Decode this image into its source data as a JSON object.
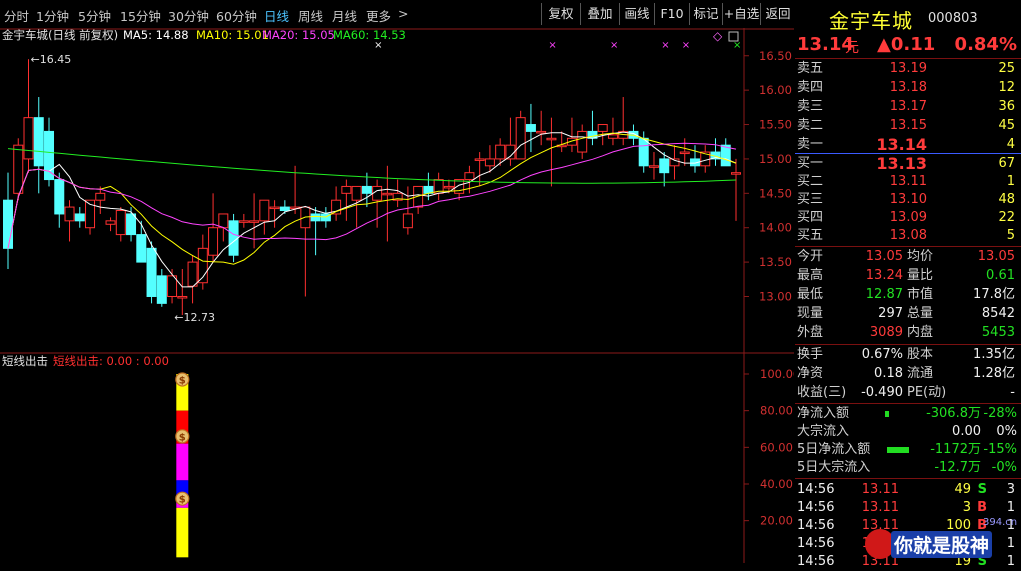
{
  "toolbar": {
    "timeframes": [
      "分时",
      "1分钟",
      "5分钟",
      "15分钟",
      "30分钟",
      "60分钟",
      "日线",
      "周线",
      "月线",
      "更多"
    ],
    "active": "日线",
    "more_arrow": ">",
    "buttons": [
      "复权",
      "叠加",
      "画线",
      "F10",
      "标记",
      "+自选",
      "返回"
    ]
  },
  "stock": {
    "name": "金宇车城",
    "code": "000803",
    "price": "13.14",
    "unit": "元",
    "change": "▲0.11",
    "pct": "0.84%"
  },
  "main_chart": {
    "header_title": "金宇车城(日线 前复权)",
    "ma": [
      {
        "label": "MA5: 14.88",
        "color": "#ffffff"
      },
      {
        "label": "MA10: 15.01",
        "color": "#ffff00"
      },
      {
        "label": "MA20: 15.05",
        "color": "#ff44ff"
      },
      {
        "label": "MA60: 14.53",
        "color": "#22ee22"
      }
    ],
    "high_label": "16.45",
    "low_label": "12.73",
    "y_ticks": [
      "16.50",
      "16.00",
      "15.50",
      "15.00",
      "14.50",
      "14.00",
      "13.50",
      "13.00"
    ],
    "marker_glyph": "×",
    "diamond_glyph": "◇"
  },
  "chart_data": {
    "type": "candlestick",
    "ylim": [
      12.6,
      16.7
    ],
    "candles": [
      [
        14.4,
        14.8,
        13.4,
        13.7
      ],
      [
        14.5,
        15.3,
        14.4,
        15.2
      ],
      [
        15.0,
        16.45,
        14.8,
        15.6
      ],
      [
        15.6,
        15.9,
        14.5,
        14.9
      ],
      [
        15.4,
        15.6,
        14.6,
        14.7
      ],
      [
        14.7,
        14.8,
        14.0,
        14.2
      ],
      [
        14.1,
        14.4,
        13.8,
        14.3
      ],
      [
        14.2,
        14.3,
        14.0,
        14.1
      ],
      [
        14.0,
        14.4,
        13.9,
        14.4
      ],
      [
        14.4,
        14.6,
        14.2,
        14.5
      ],
      [
        14.05,
        14.15,
        13.95,
        14.1
      ],
      [
        13.9,
        14.3,
        13.8,
        14.25
      ],
      [
        14.2,
        14.3,
        13.8,
        13.9
      ],
      [
        13.9,
        14.1,
        13.5,
        13.5
      ],
      [
        13.7,
        13.8,
        12.9,
        13.0
      ],
      [
        13.3,
        13.4,
        12.85,
        12.9
      ],
      [
        13.0,
        13.4,
        12.9,
        13.3
      ],
      [
        13.0,
        13.4,
        12.73,
        13.0
      ],
      [
        13.15,
        13.6,
        12.9,
        13.5
      ],
      [
        13.2,
        13.9,
        13.1,
        13.7
      ],
      [
        13.6,
        14.5,
        13.5,
        14.0
      ],
      [
        14.0,
        14.1,
        13.8,
        14.2
      ],
      [
        14.1,
        14.2,
        13.5,
        13.6
      ],
      [
        14.1,
        14.2,
        14.0,
        14.1
      ],
      [
        14.1,
        14.5,
        13.7,
        14.1
      ],
      [
        14.1,
        14.4,
        13.9,
        14.4
      ],
      [
        14.3,
        14.4,
        14.0,
        14.3
      ],
      [
        14.3,
        14.4,
        14.2,
        14.25
      ],
      [
        14.3,
        14.9,
        14.2,
        14.3
      ],
      [
        14.0,
        14.3,
        13.0,
        14.3
      ],
      [
        14.2,
        14.3,
        13.6,
        14.1
      ],
      [
        14.2,
        14.3,
        14.0,
        14.1
      ],
      [
        14.2,
        14.6,
        14.1,
        14.4
      ],
      [
        14.5,
        14.7,
        14.1,
        14.6
      ],
      [
        14.4,
        14.6,
        14.0,
        14.6
      ],
      [
        14.6,
        14.8,
        14.3,
        14.5
      ],
      [
        14.4,
        14.7,
        14.0,
        14.6
      ],
      [
        14.5,
        14.9,
        13.8,
        14.5
      ],
      [
        14.4,
        14.7,
        14.3,
        14.5
      ],
      [
        14.0,
        14.6,
        13.9,
        14.2
      ],
      [
        14.3,
        14.6,
        14.2,
        14.6
      ],
      [
        14.6,
        14.8,
        14.4,
        14.5
      ],
      [
        14.5,
        14.8,
        14.4,
        14.7
      ],
      [
        14.6,
        14.7,
        14.5,
        14.6
      ],
      [
        14.5,
        14.7,
        14.4,
        14.7
      ],
      [
        14.7,
        14.9,
        14.5,
        14.8
      ],
      [
        15.0,
        15.1,
        14.6,
        15.0
      ],
      [
        14.9,
        15.2,
        14.8,
        15.0
      ],
      [
        15.0,
        15.3,
        14.9,
        15.2
      ],
      [
        15.0,
        15.6,
        14.9,
        15.2
      ],
      [
        15.0,
        15.7,
        15.0,
        15.6
      ],
      [
        15.5,
        15.8,
        15.1,
        15.4
      ],
      [
        15.4,
        15.7,
        15.2,
        15.4
      ],
      [
        15.3,
        15.6,
        14.6,
        15.3
      ],
      [
        15.2,
        15.4,
        15.1,
        15.2
      ],
      [
        15.2,
        15.6,
        15.1,
        15.3
      ],
      [
        15.1,
        15.5,
        15.0,
        15.4
      ],
      [
        15.4,
        15.7,
        15.2,
        15.3
      ],
      [
        15.4,
        15.5,
        15.2,
        15.5
      ],
      [
        15.3,
        15.6,
        15.2,
        15.35
      ],
      [
        15.3,
        15.9,
        15.2,
        15.4
      ],
      [
        15.4,
        15.5,
        15.2,
        15.3
      ],
      [
        15.3,
        15.4,
        14.8,
        14.9
      ],
      [
        14.9,
        15.1,
        14.7,
        14.9
      ],
      [
        15.0,
        15.1,
        14.6,
        14.8
      ],
      [
        14.9,
        15.2,
        14.7,
        15.0
      ],
      [
        15.1,
        15.3,
        14.9,
        15.1
      ],
      [
        15.0,
        15.2,
        14.8,
        14.9
      ],
      [
        14.9,
        15.2,
        14.8,
        15.1
      ],
      [
        15.1,
        15.3,
        14.9,
        15.0
      ],
      [
        15.2,
        15.3,
        14.9,
        14.9
      ],
      [
        14.8,
        15.0,
        14.1,
        14.8
      ]
    ],
    "marks": [
      [
        36,
        "#f5f5f5"
      ],
      [
        53,
        "#ff44ff"
      ],
      [
        59,
        "#ff44ff"
      ],
      [
        71,
        "#22ee22"
      ]
    ]
  },
  "sub_chart": {
    "title": "短线出击",
    "value_label": "短线出击: 0.00 : 0.00",
    "y_ticks": [
      "100.00",
      "80.00",
      "60.00",
      "40.00",
      "20.00"
    ],
    "coin_glyph": "$",
    "bar": [
      {
        "color": "#ffff00",
        "from": 100,
        "to": 80
      },
      {
        "color": "#ff0000",
        "from": 80,
        "to": 62
      },
      {
        "color": "#ff00ff",
        "from": 62,
        "to": 42
      },
      {
        "color": "#0000ff",
        "from": 42,
        "to": 32
      },
      {
        "color": "#ff00ff",
        "from": 32,
        "to": 27
      },
      {
        "color": "#ffff00",
        "from": 27,
        "to": 0
      }
    ]
  },
  "quote": {
    "sell": [
      [
        "卖五",
        "13.19",
        "25"
      ],
      [
        "卖四",
        "13.18",
        "12"
      ],
      [
        "卖三",
        "13.17",
        "36"
      ],
      [
        "卖二",
        "13.15",
        "45"
      ],
      [
        "卖一",
        "13.14",
        "4"
      ]
    ],
    "buy": [
      [
        "买一",
        "13.13",
        "67"
      ],
      [
        "买二",
        "13.11",
        "1"
      ],
      [
        "买三",
        "13.10",
        "48"
      ],
      [
        "买四",
        "13.09",
        "22"
      ],
      [
        "买五",
        "13.08",
        "5"
      ]
    ],
    "stats": [
      [
        "今开",
        "13.05",
        "red",
        "均价",
        "13.05",
        "red"
      ],
      [
        "最高",
        "13.24",
        "red",
        "量比",
        "0.61",
        "green"
      ],
      [
        "最低",
        "12.87",
        "green",
        "市值",
        "17.8亿",
        "white"
      ],
      [
        "现量",
        "297",
        "white",
        "总量",
        "8542",
        "white"
      ],
      [
        "外盘",
        "3089",
        "red",
        "内盘",
        "5453",
        "green"
      ]
    ],
    "fund": [
      [
        "换手",
        "0.67%",
        "股本",
        "1.35亿"
      ],
      [
        "净资",
        "0.18",
        "流通",
        "1.28亿"
      ],
      [
        "收益(三)",
        "-0.490",
        "PE(动)",
        "-"
      ]
    ],
    "flow": [
      [
        "净流入额",
        "-306.8万",
        "-28%"
      ],
      [
        "大宗流入",
        "0.00",
        "0%"
      ],
      [
        "5日净流入额",
        "-1172万",
        "-15%"
      ],
      [
        "5日大宗流入",
        "-12.7万",
        "-0%"
      ]
    ],
    "ticks": [
      [
        "14:56",
        "13.11",
        "49",
        "S",
        "3"
      ],
      [
        "14:56",
        "13.11",
        "3",
        "B",
        "1"
      ],
      [
        "14:56",
        "13.11",
        "100",
        "B",
        "1"
      ],
      [
        "14:56",
        "13.11",
        "14",
        "S",
        "1"
      ],
      [
        "14:56",
        "13.11",
        "19",
        "S",
        "1"
      ]
    ]
  },
  "watermark": {
    "text": "你就是股神",
    "sub": "394.cn"
  }
}
